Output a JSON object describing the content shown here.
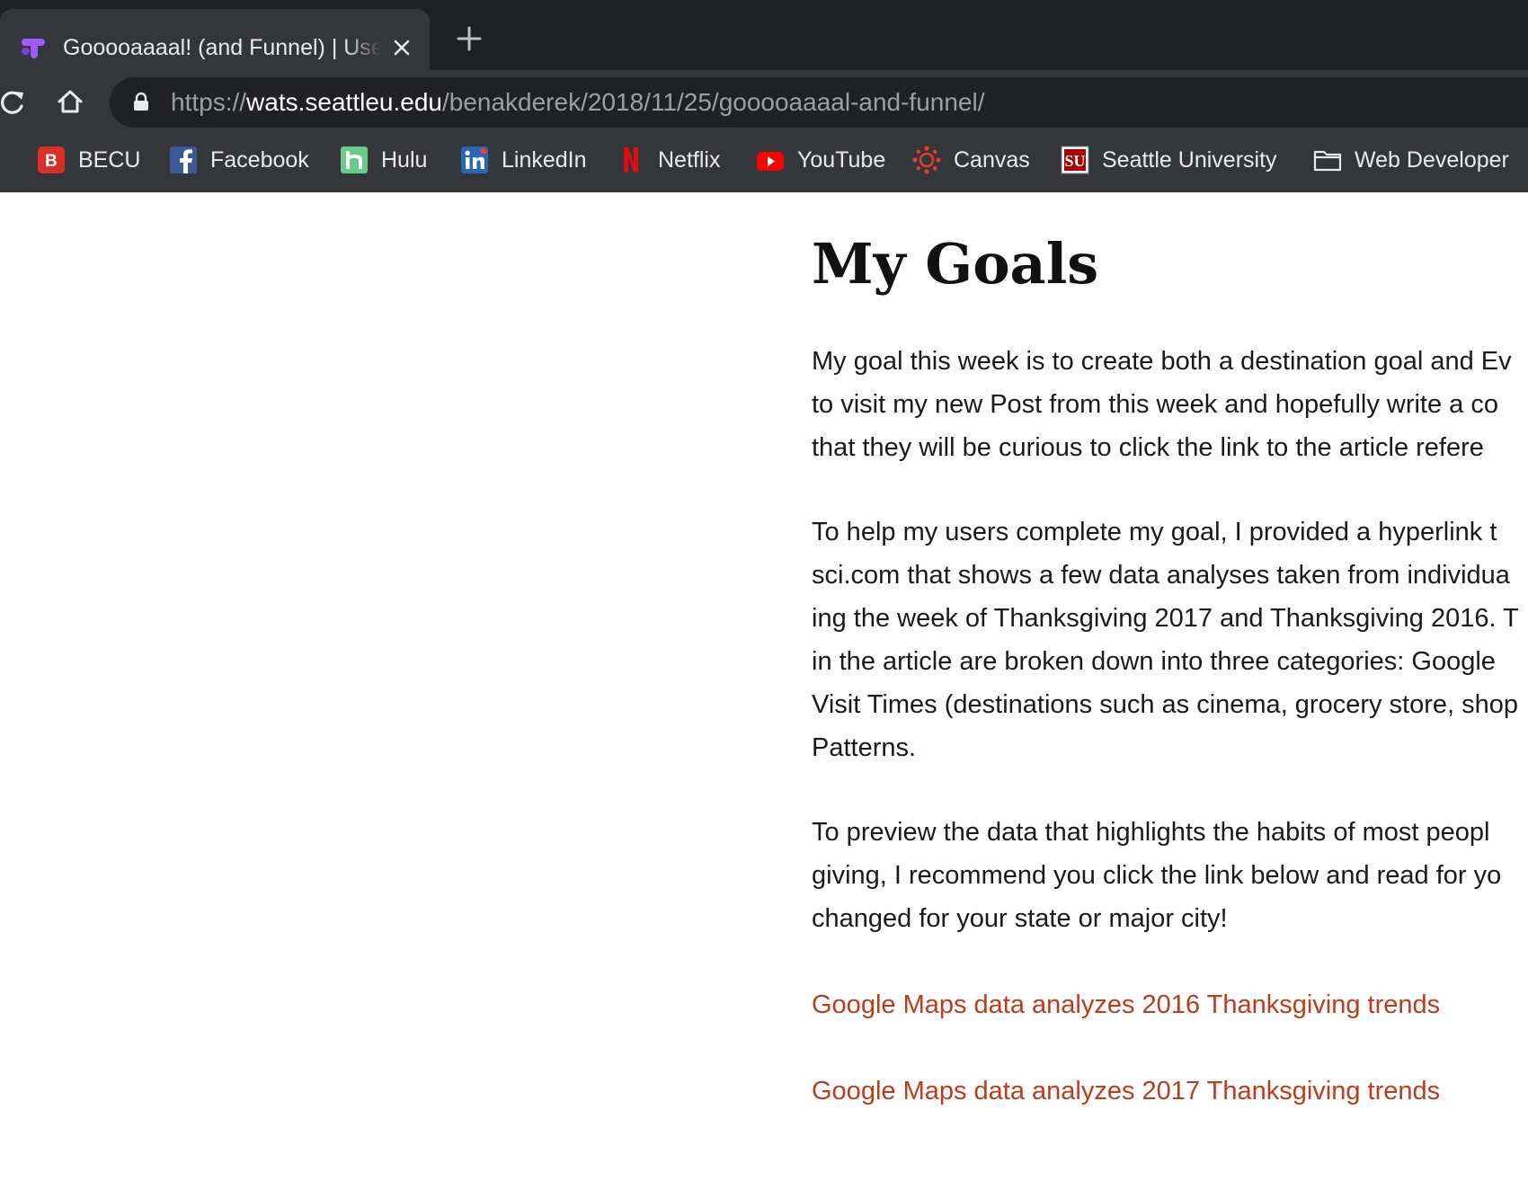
{
  "browser": {
    "tab": {
      "title": "Gooooaaaal! (and Funnel) | User"
    },
    "url": {
      "scheme": "https://",
      "host": "wats.seattleu.edu",
      "path": "/benakderek/2018/11/25/gooooaaaal-and-funnel/"
    },
    "bookmarks": [
      {
        "label": "BECU",
        "icon": "becu-icon",
        "color": "#d93025"
      },
      {
        "label": "Facebook",
        "icon": "facebook-icon",
        "color": "#3b5998"
      },
      {
        "label": "Hulu",
        "icon": "hulu-icon",
        "color": "#66cc87"
      },
      {
        "label": "LinkedIn",
        "icon": "linkedin-icon",
        "color": "#2867b2"
      },
      {
        "label": "Netflix",
        "icon": "netflix-icon",
        "color": "#e50914"
      },
      {
        "label": "YouTube",
        "icon": "youtube-icon",
        "color": "#ff0000"
      },
      {
        "label": "Canvas",
        "icon": "canvas-icon",
        "color": "#e13f2b"
      },
      {
        "label": "Seattle University",
        "icon": "seattle-university-icon",
        "color": "#aa0000"
      },
      {
        "label": "Web Developer",
        "icon": "folder-icon",
        "color": "#e8eaed"
      }
    ]
  },
  "page": {
    "heading": "My Goals",
    "paragraphs": [
      {
        "lines": [
          "My goal this week is to create both a destination goal and Ev",
          "to visit my new Post from this week and hopefully write a co",
          "that they will be curious to click the link to the article refere"
        ]
      },
      {
        "lines": [
          "To help my users complete my goal, I  provided a hyperlink t",
          "sci.com that shows a few data analyses taken from individua",
          "ing the week of Thanksgiving 2017 and Thanksgiving 2016. T",
          "in the article are broken down into three categories: Google",
          "Visit Times (destinations such as cinema, grocery store, shop",
          "Patterns."
        ]
      },
      {
        "lines": [
          "To preview the data that highlights the habits of most peopl",
          "giving, I recommend you click the link below and read for yo",
          "changed for your state or major city!"
        ]
      }
    ],
    "links": [
      "Google Maps data analyzes 2016 Thanksgiving trends",
      "Google Maps data analyzes 2017 Thanksgiving trends"
    ],
    "link_color": "#b93d1e"
  }
}
